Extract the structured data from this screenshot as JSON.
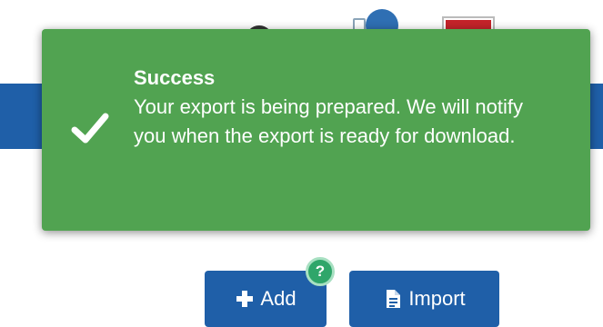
{
  "toast": {
    "title": "Success",
    "message": "Your export is being prepared. We will notify you when the export is ready for download.",
    "icon": "checkmark-icon",
    "background_color": "#51a351"
  },
  "actions": {
    "add_label": "Add",
    "add_icon": "plus-icon",
    "import_label": "Import",
    "import_icon": "file-icon",
    "help_badge_text": "?",
    "button_color": "#1f5fa8"
  },
  "header": {
    "accent_color": "#1f5fa8"
  }
}
